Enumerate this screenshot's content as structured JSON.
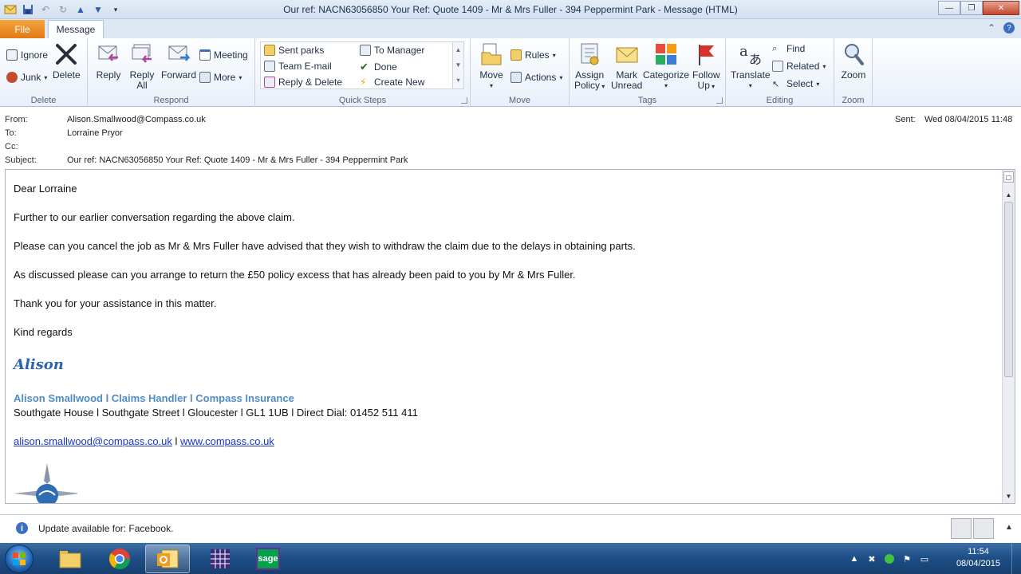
{
  "window": {
    "title": "Our ref: NACN63056850   Your Ref: Quote 1409 - Mr & Mrs Fuller - 394 Peppermint Park  -  Message (HTML)",
    "min": "—",
    "max": "❐",
    "close": "✕"
  },
  "tabs": {
    "file": "File",
    "message": "Message"
  },
  "ribbon": {
    "delete": {
      "label": "Delete",
      "ignore": "Ignore",
      "junk": "Junk",
      "delete": "Delete"
    },
    "respond": {
      "label": "Respond",
      "reply": "Reply",
      "reply_all_1": "Reply",
      "reply_all_2": "All",
      "forward": "Forward",
      "meeting": "Meeting",
      "more": "More"
    },
    "quick_steps": {
      "label": "Quick Steps",
      "items": [
        "Sent parks",
        "To Manager",
        "Team E-mail",
        "Done",
        "Reply & Delete",
        "Create New"
      ]
    },
    "move": {
      "label": "Move",
      "move": "Move",
      "rules": "Rules",
      "actions": "Actions"
    },
    "tags": {
      "label": "Tags",
      "assign_1": "Assign",
      "assign_2": "Policy",
      "mark_1": "Mark",
      "mark_2": "Unread",
      "categorize": "Categorize",
      "follow_1": "Follow",
      "follow_2": "Up"
    },
    "editing": {
      "label": "Editing",
      "translate": "Translate",
      "find": "Find",
      "related": "Related",
      "select": "Select"
    },
    "zoom": {
      "label": "Zoom",
      "zoom": "Zoom"
    }
  },
  "header": {
    "from_label": "From:",
    "from": "Alison.Smallwood@Compass.co.uk",
    "to_label": "To:",
    "to": "Lorraine Pryor",
    "cc_label": "Cc:",
    "subject_label": "Subject:",
    "subject": "Our ref: NACN63056850   Your Ref: Quote 1409 - Mr & Mrs Fuller - 394 Peppermint Park",
    "sent_label": "Sent:",
    "sent": "Wed 08/04/2015 11:48"
  },
  "body": {
    "greeting": "Dear Lorraine",
    "p1": "Further to our earlier conversation regarding the above claim.",
    "p2": "Please can you cancel the job as Mr & Mrs Fuller have advised that they wish to withdraw the claim due to the delays in obtaining parts.",
    "p3": "As discussed please can you arrange to return the £50 policy excess that has already been paid to you by Mr & Mrs Fuller.",
    "p4": "Thank you for your assistance in this matter.",
    "closing": "Kind regards",
    "sig_name": "Alison",
    "sig_title": "Alison Smallwood l Claims Handler l Compass Insurance",
    "sig_address": "Southgate House l Southgate Street l Gloucester l GL1 1UB l Direct Dial: 01452 511 411",
    "email_link": "alison.smallwood@compass.co.uk",
    "sep": " l ",
    "web_link": "www.compass.co.uk"
  },
  "infobar": {
    "text": "Update available for: Facebook."
  },
  "taskbar": {
    "time": "11:54",
    "date": "08/04/2015",
    "sage_label": "sage"
  },
  "colors": {
    "file_tab": "#e47a16",
    "link": "#1a36c8",
    "sig_title": "#4d8cc8",
    "sig_name": "#2d64b0"
  }
}
